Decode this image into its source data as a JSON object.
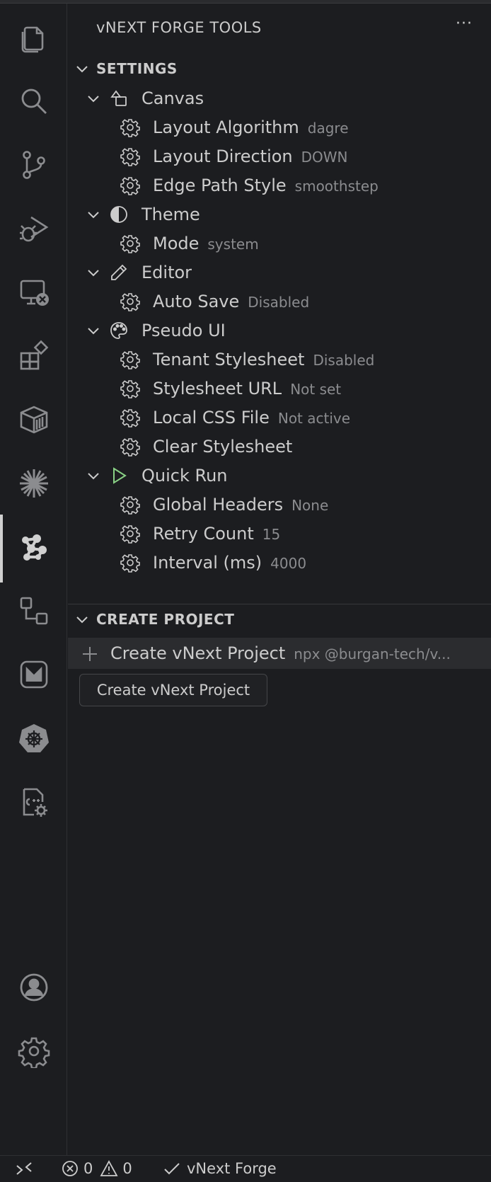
{
  "sidebar": {
    "title": "vNEXT FORGE TOOLS",
    "more": "···",
    "settings_section": {
      "label": "SETTINGS",
      "categories": [
        {
          "label": "Canvas",
          "icon": "shapes-icon",
          "items": [
            {
              "label": "Layout Algorithm",
              "value": "dagre"
            },
            {
              "label": "Layout Direction",
              "value": "DOWN"
            },
            {
              "label": "Edge Path Style",
              "value": "smoothstep"
            }
          ]
        },
        {
          "label": "Theme",
          "icon": "half-circle-icon",
          "items": [
            {
              "label": "Mode",
              "value": "system"
            }
          ]
        },
        {
          "label": "Editor",
          "icon": "pencil-icon",
          "items": [
            {
              "label": "Auto Save",
              "value": "Disabled"
            }
          ]
        },
        {
          "label": "Pseudo UI",
          "icon": "palette-icon",
          "items": [
            {
              "label": "Tenant Stylesheet",
              "value": "Disabled"
            },
            {
              "label": "Stylesheet URL",
              "value": "Not set"
            },
            {
              "label": "Local CSS File",
              "value": "Not active"
            },
            {
              "label": "Clear Stylesheet",
              "value": ""
            }
          ]
        },
        {
          "label": "Quick Run",
          "icon": "play-icon",
          "icon_color": "#89d185",
          "items": [
            {
              "label": "Global Headers",
              "value": "None"
            },
            {
              "label": "Retry Count",
              "value": "15"
            },
            {
              "label": "Interval (ms)",
              "value": "4000"
            }
          ]
        }
      ]
    },
    "create_section": {
      "label": "CREATE PROJECT",
      "item": {
        "label": "Create vNext Project",
        "value": "npx @burgan-tech/v..."
      },
      "tooltip": "Create vNext Project"
    }
  },
  "activity_bar": [
    "explorer-icon",
    "search-icon",
    "source-control-icon",
    "run-debug-icon",
    "remote-explorer-icon",
    "extensions-icon",
    "containers-icon",
    "sparkle-icon",
    "vnext-forge-icon",
    "diagram-icon",
    "m-logo-icon",
    "kubernetes-icon",
    "cpp-settings-icon"
  ],
  "activity_bottom": [
    "account-icon",
    "settings-gear-icon"
  ],
  "status_bar": {
    "errors": "0",
    "warnings": "0",
    "forge_label": "vNext Forge"
  },
  "colors": {
    "background": "#1c1d20",
    "text": "#cccccc",
    "muted": "#8b8c8f",
    "play_green": "#89d185"
  }
}
